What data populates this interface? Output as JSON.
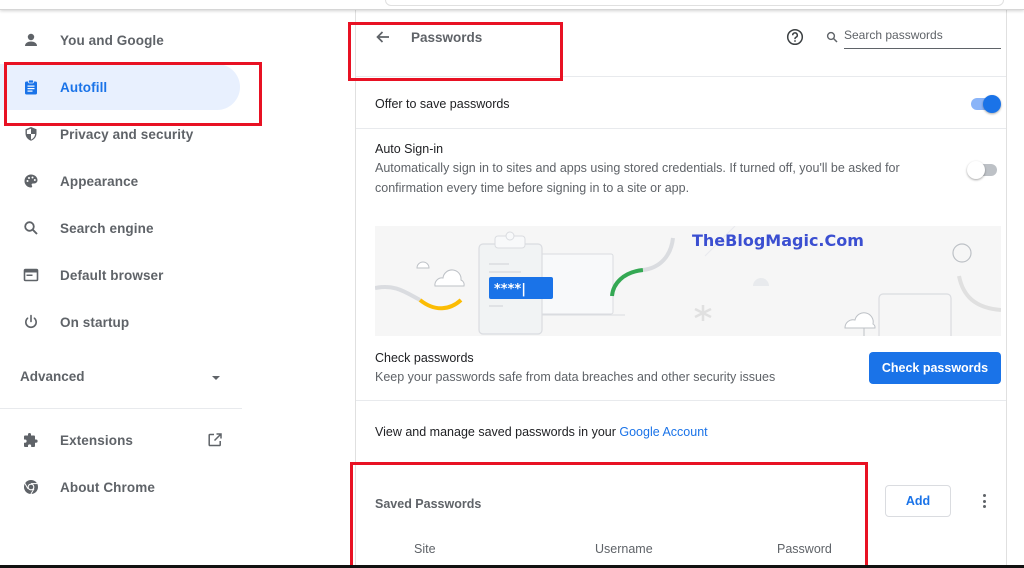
{
  "sidebar": {
    "items": [
      {
        "label": "You and Google",
        "icon": "person-icon",
        "active": false
      },
      {
        "label": "Autofill",
        "icon": "clipboard-icon",
        "active": true
      },
      {
        "label": "Privacy and security",
        "icon": "shield-icon",
        "active": false
      },
      {
        "label": "Appearance",
        "icon": "palette-icon",
        "active": false
      },
      {
        "label": "Search engine",
        "icon": "search-icon",
        "active": false
      },
      {
        "label": "Default browser",
        "icon": "browser-window-icon",
        "active": false
      },
      {
        "label": "On startup",
        "icon": "power-icon",
        "active": false
      }
    ],
    "advanced_label": "Advanced",
    "extensions_label": "Extensions",
    "about_label": "About Chrome"
  },
  "header": {
    "title": "Passwords",
    "search_placeholder": "Search passwords",
    "search_value": ""
  },
  "settings": {
    "offer_to_save": {
      "label": "Offer to save passwords",
      "enabled": true
    },
    "auto_signin": {
      "label": "Auto Sign-in",
      "description": "Automatically sign in to sites and apps using stored credentials. If turned off, you'll be asked for confirmation every time before signing in to a site or app.",
      "enabled": false
    }
  },
  "banner": {
    "password_mask": "****|",
    "watermark": "TheBlogMagic.Com"
  },
  "check_passwords": {
    "title": "Check passwords",
    "description": "Keep your passwords safe from data breaches and other security issues",
    "button_label": "Check passwords"
  },
  "manage": {
    "text": "View and manage saved passwords in your ",
    "link_label": "Google Account"
  },
  "saved_passwords": {
    "title": "Saved Passwords",
    "add_label": "Add",
    "columns": [
      "Site",
      "Username",
      "Password"
    ]
  },
  "colors": {
    "accent": "#1a73e8",
    "active_bg": "#e8f0fe",
    "annotation_red": "#e81123",
    "watermark": "#3b4fd1"
  }
}
